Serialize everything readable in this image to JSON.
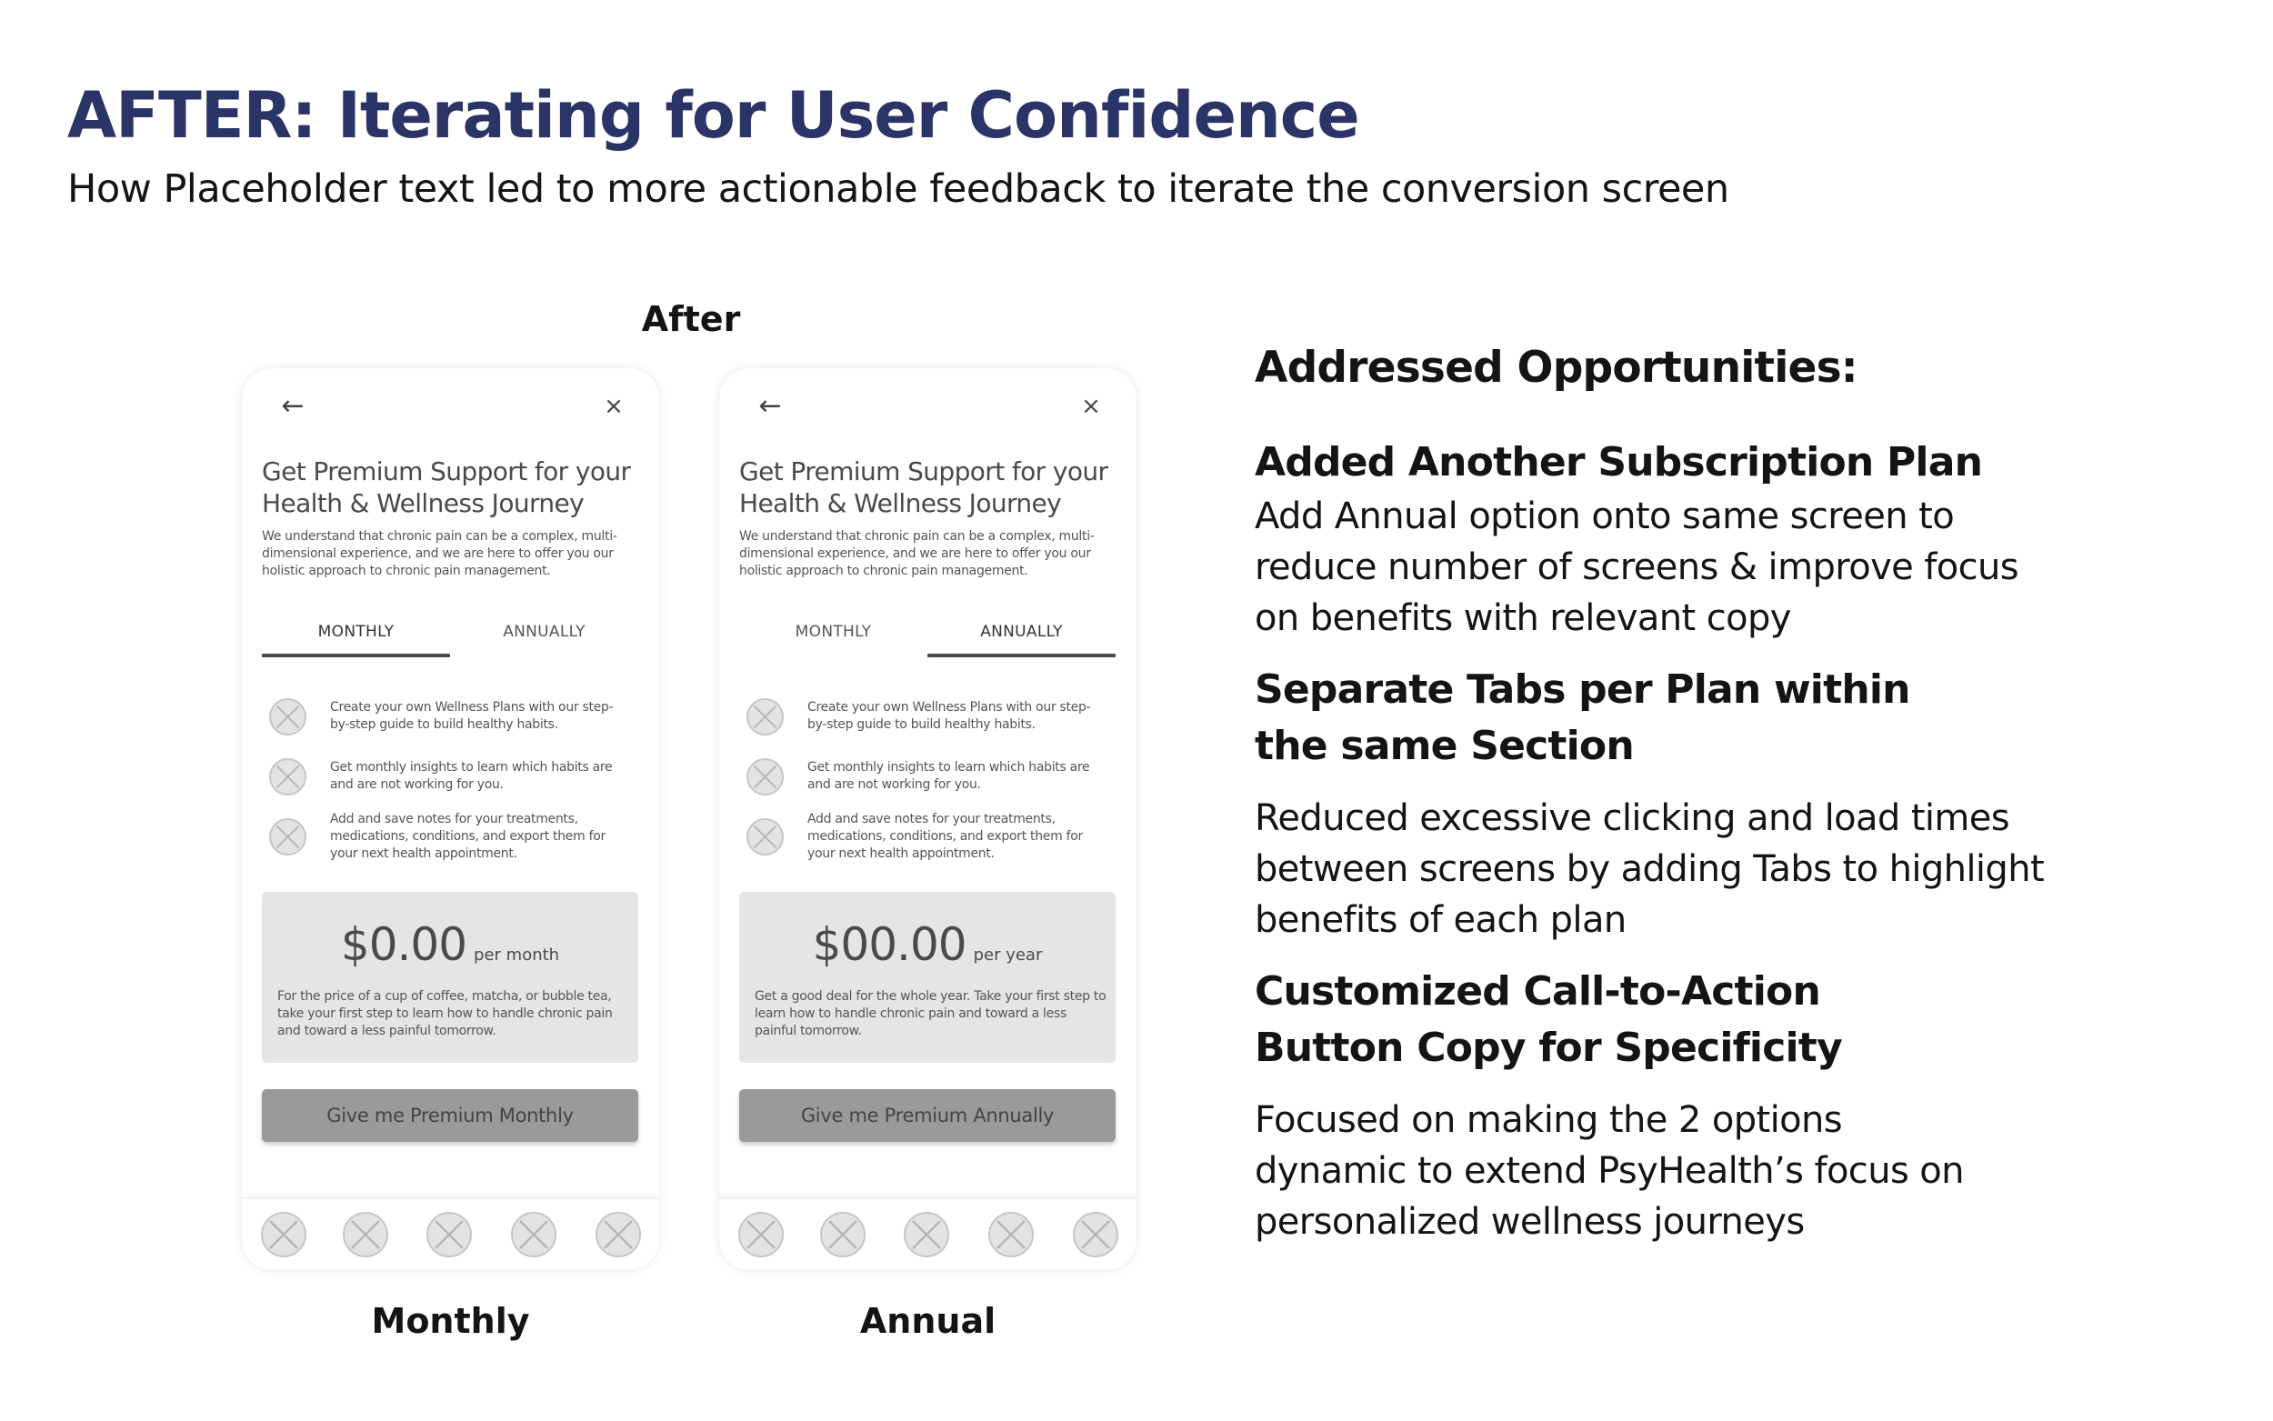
{
  "header": {
    "title": "AFTER: Iterating for User Confidence",
    "subtitle": "How Placeholder text led to more actionable feedback to iterate the conversion screen",
    "title_color": "#2B3467"
  },
  "mockups": {
    "group_label": "After",
    "phones": [
      {
        "caption": "Monthly",
        "back_icon": "arrow-left-icon",
        "close_icon": "close-icon",
        "back_glyph": "←",
        "close_glyph": "×",
        "title": "Get Premium Support for your Health & Wellness Journey",
        "description": "We understand that chronic pain can be a complex, multi-dimensional experience, and we are here to offer you our holistic approach to chronic pain management.",
        "tabs": [
          {
            "label": "MONTHLY",
            "active": true
          },
          {
            "label": "ANNUALLY",
            "active": false
          }
        ],
        "features": [
          "Create your own Wellness Plans with our step-by-step guide to build healthy habits.",
          "Get monthly insights to learn which habits are and are not working for you.",
          "Add and save notes for your treatments, medications, conditions, and export them for your next health appointment."
        ],
        "price": "$0.00",
        "period": "per month",
        "price_description": "For the price of a cup of coffee, matcha, or bubble tea, take your first step to learn how to handle chronic pain and toward a less painful tomorrow.",
        "cta": "Give me Premium Monthly",
        "nav_icons": [
          "placeholder-icon",
          "placeholder-icon",
          "placeholder-icon",
          "placeholder-icon",
          "placeholder-icon"
        ]
      },
      {
        "caption": "Annual",
        "back_icon": "arrow-left-icon",
        "close_icon": "close-icon",
        "back_glyph": "←",
        "close_glyph": "×",
        "title": "Get Premium Support for your Health & Wellness Journey",
        "description": "We understand that chronic pain can be a complex, multi-dimensional experience, and we are here to offer you our holistic approach to chronic pain management.",
        "tabs": [
          {
            "label": "MONTHLY",
            "active": false
          },
          {
            "label": "ANNUALLY",
            "active": true
          }
        ],
        "features": [
          "Create your own Wellness Plans with our step-by-step guide to build healthy habits.",
          "Get monthly insights to learn which habits are and are not working for you.",
          "Add and save notes for your treatments, medications, conditions, and export them for your next health appointment."
        ],
        "price": "$00.00",
        "period": "per year",
        "price_description": "Get a good deal for the whole year. Take your first step to learn how to handle chronic pain and toward a less painful tomorrow.",
        "cta": "Give me Premium Annually",
        "nav_icons": [
          "placeholder-icon",
          "placeholder-icon",
          "placeholder-icon",
          "placeholder-icon",
          "placeholder-icon"
        ]
      }
    ]
  },
  "notes": {
    "heading": "Addressed Opportunities:",
    "sections": [
      {
        "title": "Added Another Subscription Plan",
        "body": "Add Annual option onto same screen to reduce number of screens & improve focus on benefits with relevant copy"
      },
      {
        "title": "Separate Tabs per Plan within the same Section",
        "body": "Reduced excessive clicking and load times between screens by adding Tabs to highlight benefits of each plan"
      },
      {
        "title": "Customized Call-to-Action Button Copy for Specificity",
        "body": "Focused on making the 2 options dynamic to extend PsyHealth’s focus on personalized wellness journeys"
      }
    ]
  }
}
